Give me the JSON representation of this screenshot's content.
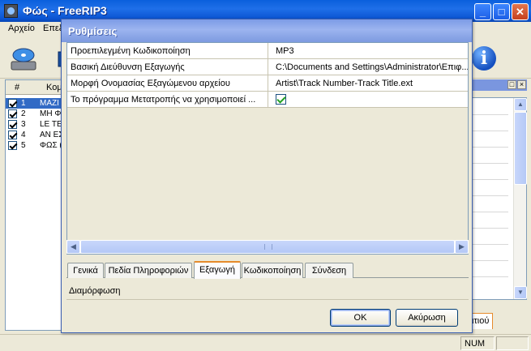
{
  "window": {
    "title": "Φώς - FreeRIP3"
  },
  "window_buttons": {
    "minimize": "_",
    "maximize": "□",
    "close": "✕"
  },
  "menu": [
    "Αρχείο",
    "Επεξ"
  ],
  "info_glyph": "i",
  "track_list": {
    "headers": {
      "num": "#",
      "title": "Κομ"
    },
    "rows": [
      {
        "num": "1",
        "title": "ΜΑΖΙ",
        "checked": true,
        "selected": true
      },
      {
        "num": "2",
        "title": "ΜΗ Φ",
        "checked": true,
        "selected": false
      },
      {
        "num": "3",
        "title": "LE TEI",
        "checked": true,
        "selected": false
      },
      {
        "num": "4",
        "title": "ΑΝ ΕΣ",
        "checked": true,
        "selected": false
      },
      {
        "num": "5",
        "title": "ΦΩΣ (",
        "checked": true,
        "selected": false
      }
    ]
  },
  "right_panel": {
    "tab_label": "ιτιού"
  },
  "statusbar": {
    "num": "NUM"
  },
  "dialog": {
    "title": "Ρυθμίσεις",
    "rows": [
      {
        "label": "Προεπιλεγμένη Κωδικοποίηση",
        "value": "MP3"
      },
      {
        "label": "Βασική Διεύθυνση Εξαγωγής",
        "value": "C:\\Documents and Settings\\Administrator\\Επιφ..."
      },
      {
        "label": "Μορφή Ονομασίας Εξαγώμενου αρχείου",
        "value": "Artist\\Track Number-Track Title.ext"
      },
      {
        "label": "Το πρόγραμμα Μετατροπής να χρησιμοποιεί ...",
        "value": "",
        "checked": true
      }
    ],
    "tabs": [
      "Γενικά",
      "Πεδία Πληροφοριών",
      "Εξαγωγή",
      "Κωδικοποίηση",
      "Σύνδεση"
    ],
    "active_tab": "Εξαγωγή",
    "description": "Διαμόρφωση",
    "ok_label": "OK",
    "cancel_label": "Ακύρωση"
  },
  "colors": {
    "title_blue": "#0b54d2",
    "dialog_title": "#8aa6ea",
    "selection": "#316ac5",
    "tab_accent": "#e68b2c"
  }
}
